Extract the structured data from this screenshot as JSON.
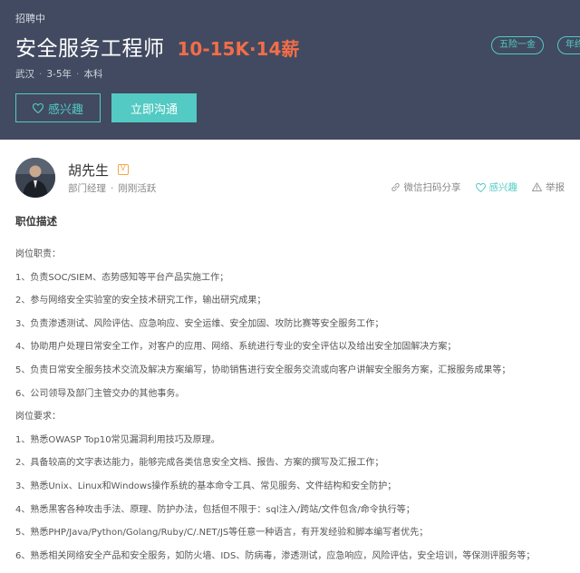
{
  "header": {
    "status": "招聘中",
    "job_title": "安全服务工程师",
    "salary": "10-15K·14薪",
    "location": "武汉",
    "experience": "3-5年",
    "education": "本科",
    "tags": [
      "五险一金",
      "年终奖"
    ],
    "interest_label": "感兴趣",
    "chat_label": "立即沟通"
  },
  "recruiter": {
    "name": "胡先生",
    "title": "部门经理",
    "activity": "刚刚活跃",
    "share_label": "微信扫码分享",
    "interest_label": "感兴趣",
    "report_label": "举报"
  },
  "description": {
    "section_title": "职位描述",
    "lines": [
      "岗位职责：",
      "1、负责SOC/SIEM、态势感知等平台产品实施工作；",
      "2、参与网络安全实验室的安全技术研究工作，输出研究成果；",
      "3、负责渗透测试、风险评估、应急响应、安全运维、安全加固、攻防比赛等安全服务工作；",
      "4、协助用户处理日常安全工作，对客户的应用、网络、系统进行专业的安全评估以及给出安全加固解决方案；",
      "5、负责日常安全服务技术交流及解决方案编写，协助销售进行安全服务交流或向客户讲解安全服务方案，汇报服务成果等；",
      "6、公司领导及部门主管交办的其他事务。",
      "岗位要求：",
      "1、熟悉OWASP Top10常见漏洞利用技巧及原理。",
      "2、具备较高的文字表达能力，能够完成各类信息安全文档、报告、方案的撰写及汇报工作；",
      "3、熟悉Unix、Linux和Windows操作系统的基本命令工具、常见服务、文件结构和安全防护；",
      "4、熟悉黑客各种攻击手法、原理、防护办法，包括但不限于：sql注入/跨站/文件包含/命令执行等；",
      "5、熟悉PHP/Java/Python/Golang/Ruby/C/.NET/JS等任意一种语言，有开发经验和脚本编写者优先；",
      "6、熟悉相关网络安全产品和安全服务，如防火墙、IDS、防病毒，渗透测试，应急响应，风险评估，安全培训，等保测评服务等；"
    ]
  },
  "colors": {
    "header_bg": "#414a60",
    "accent": "#53cac3",
    "salary": "#f26d49"
  }
}
